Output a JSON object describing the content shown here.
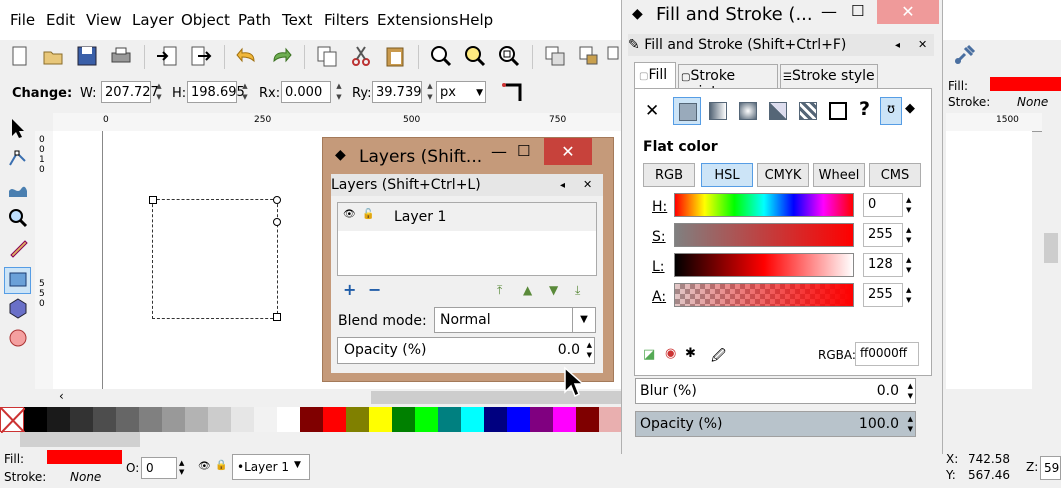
{
  "menu": [
    "File",
    "Edit",
    "View",
    "Layer",
    "Object",
    "Path",
    "Text",
    "Filters",
    "Extensions",
    "Help"
  ],
  "controls": {
    "change_label": "Change:",
    "w_label": "W:",
    "w_value": "207.727",
    "h_label": "H:",
    "h_value": "198.695",
    "rx_label": "Rx:",
    "rx_value": "0.000",
    "ry_label": "Ry:",
    "ry_value": "39.739",
    "unit": "px"
  },
  "ruler": {
    "h_ticks": [
      "0",
      "250",
      "500",
      "750",
      "1500"
    ],
    "v_ticks": [
      "0",
      "0",
      "1",
      "0",
      "5",
      "5",
      "0",
      "5"
    ]
  },
  "right_strip": {
    "fill_label": "Fill:",
    "stroke_label": "Stroke:",
    "stroke_value": "None",
    "fill_color": "#ff0000"
  },
  "layers_dialog": {
    "window_title": "Layers (Shift...",
    "panel_title": "Layers (Shift+Ctrl+L)",
    "layer_name": "Layer 1",
    "blend_label": "Blend mode:",
    "blend_value": "Normal",
    "opacity_label": "Opacity (%)",
    "opacity_value": "0.0",
    "title_color": "#c59a7a",
    "close_color": "#c7423b"
  },
  "fill_stroke": {
    "window_title": "Fill and Stroke (...",
    "panel_title": "Fill and Stroke (Shift+Ctrl+F)",
    "tabs": [
      "Fill",
      "Stroke paint",
      "Stroke style"
    ],
    "section_title": "Flat color",
    "modes": [
      "RGB",
      "HSL",
      "CMYK",
      "Wheel",
      "CMS"
    ],
    "active_mode": "HSL",
    "channels": [
      {
        "label": "H:",
        "value": "0"
      },
      {
        "label": "S:",
        "value": "255"
      },
      {
        "label": "L:",
        "value": "128"
      },
      {
        "label": "A:",
        "value": "255"
      }
    ],
    "rgba_label": "RGBA:",
    "rgba_value": "ff0000ff",
    "blur_label": "Blur (%)",
    "blur_value": "0.0",
    "opacity_label": "Opacity (%)",
    "opacity_value": "100.0"
  },
  "status": {
    "fill_label": "Fill:",
    "stroke_label": "Stroke:",
    "stroke_value": "None",
    "fill_color": "#ff0000",
    "o_label": "O:",
    "o_value": "0",
    "layer_value": "•Layer 1",
    "x_label": "X:",
    "x_value": "742.58",
    "y_label": "Y:",
    "y_value": "567.46",
    "z_label": "Z:",
    "z_value": "59"
  },
  "palette": [
    "#000000",
    "#1a1a1a",
    "#333333",
    "#4d4d4d",
    "#666666",
    "#808080",
    "#999999",
    "#b3b3b3",
    "#cccccc",
    "#e6e6e6",
    "#f2f2f2",
    "#ffffff",
    "#800000",
    "#ff0000",
    "#808000",
    "#ffff00",
    "#008000",
    "#00ff00",
    "#008080",
    "#00ffff",
    "#000080",
    "#0000ff",
    "#800080",
    "#ff00ff",
    "#7f0000",
    "#e9afaf",
    "#d35f5f",
    "#e9afaf",
    "#ffd5d5",
    "#ffaaaa",
    "#ff8080"
  ]
}
